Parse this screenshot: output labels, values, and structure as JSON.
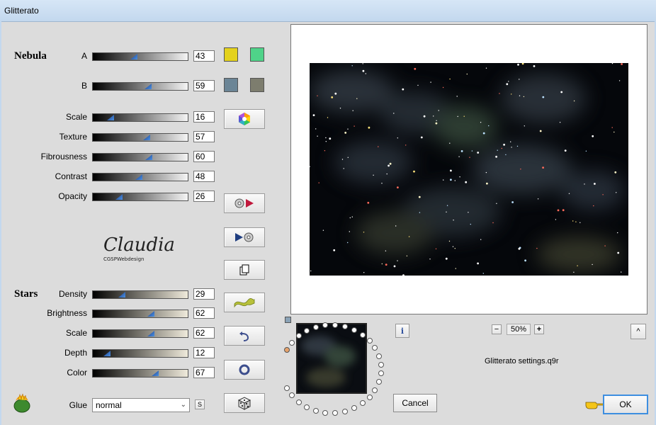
{
  "window": {
    "title": "Glitterato"
  },
  "nebula": {
    "section_label": "Nebula",
    "rows": [
      {
        "label": "A",
        "value": "43",
        "pct": 0.43
      },
      {
        "label": "B",
        "value": "59",
        "pct": 0.59
      },
      {
        "label": "Scale",
        "value": "16",
        "pct": 0.16
      },
      {
        "label": "Texture",
        "value": "57",
        "pct": 0.57
      },
      {
        "label": "Fibrousness",
        "value": "60",
        "pct": 0.6
      },
      {
        "label": "Contrast",
        "value": "48",
        "pct": 0.48
      },
      {
        "label": "Opacity",
        "value": "26",
        "pct": 0.26
      }
    ],
    "colors": {
      "a1": "#e4d21c",
      "a2": "#4fd389",
      "b1": "#6b8596",
      "b2": "#7d7d6e"
    }
  },
  "stars": {
    "section_label": "Stars",
    "rows": [
      {
        "label": "Density",
        "value": "29",
        "pct": 0.29
      },
      {
        "label": "Brightness",
        "value": "62",
        "pct": 0.62
      },
      {
        "label": "Scale",
        "value": "62",
        "pct": 0.62
      },
      {
        "label": "Depth",
        "value": "12",
        "pct": 0.12
      },
      {
        "label": "Color",
        "value": "67",
        "pct": 0.67
      }
    ],
    "glue_label": "Glue",
    "glue_value": "normal",
    "s_label": "S"
  },
  "logo": {
    "name": "Claudia",
    "tagline": "CGSPWebdesign"
  },
  "zoom": {
    "value": "50%",
    "minus": "−",
    "plus": "+"
  },
  "settings_file": "Glitterato settings.q9r",
  "buttons": {
    "cancel": "Cancel",
    "ok": "OK",
    "info": "i",
    "up": "^"
  }
}
